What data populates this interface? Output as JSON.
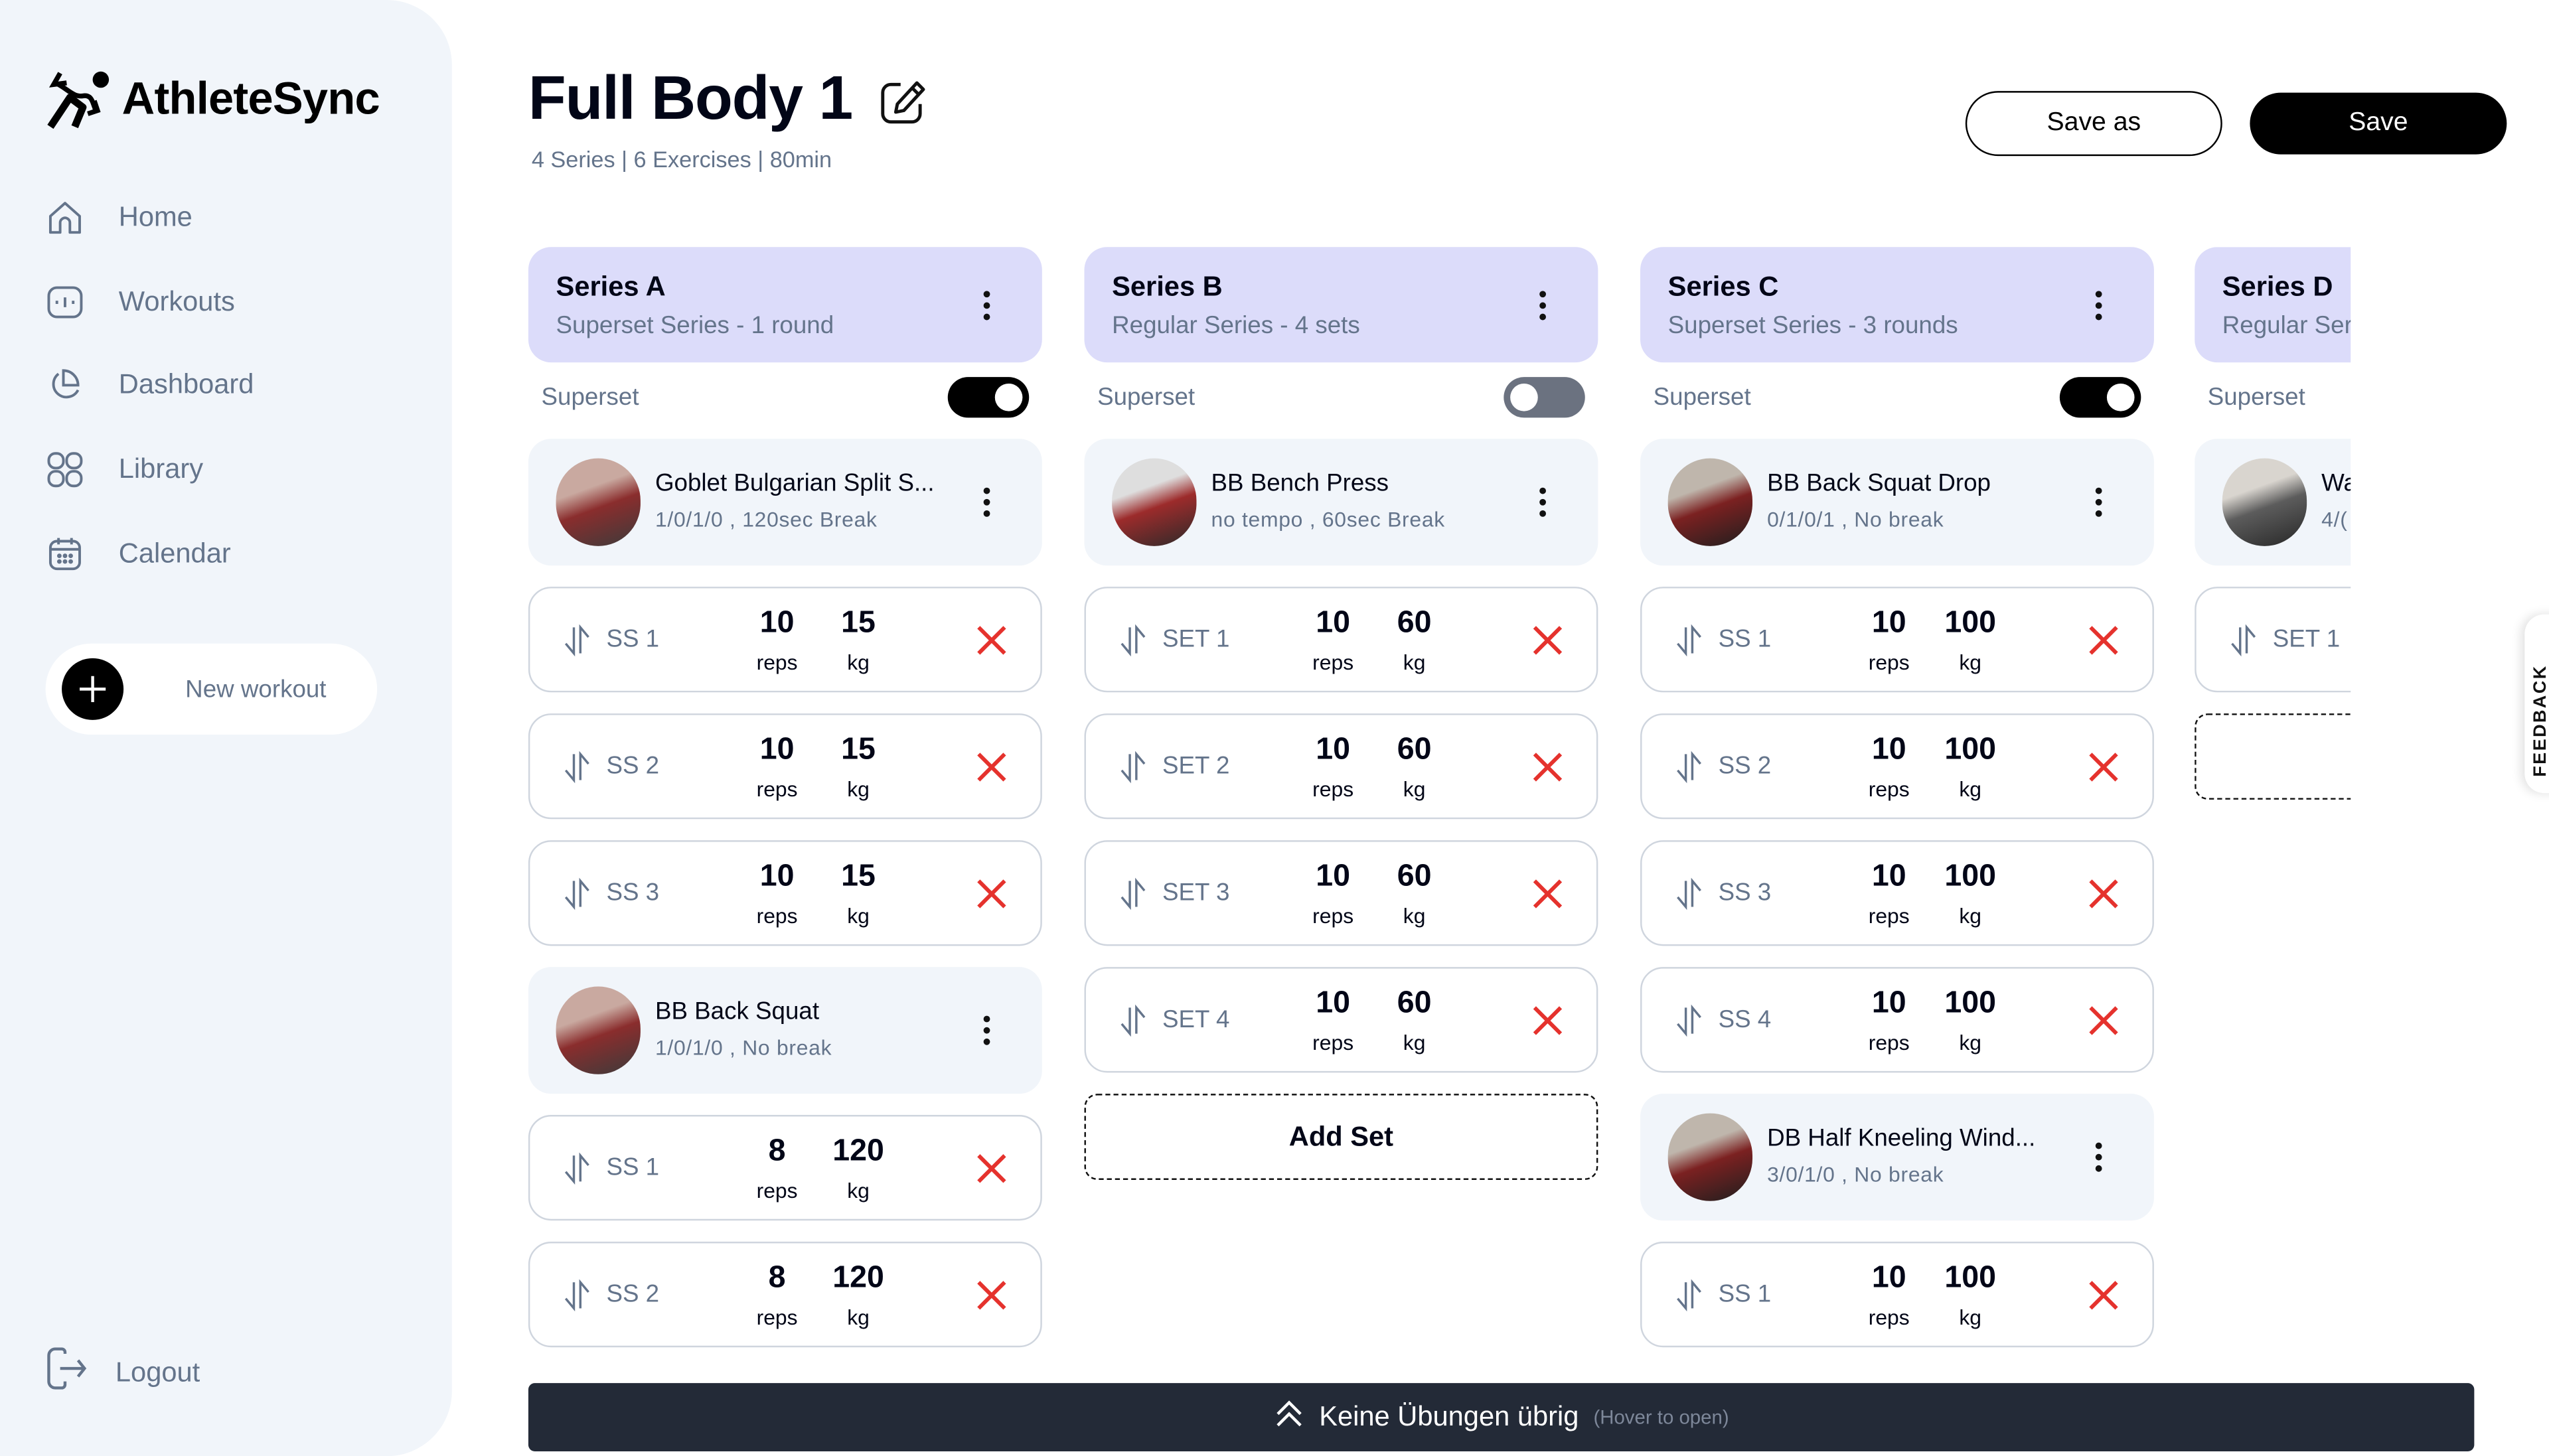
{
  "app": {
    "name": "AthleteSync"
  },
  "sidebar": {
    "items": [
      {
        "label": "Home",
        "icon": "home-icon"
      },
      {
        "label": "Workouts",
        "icon": "workouts-icon"
      },
      {
        "label": "Dashboard",
        "icon": "pie-chart-icon"
      },
      {
        "label": "Library",
        "icon": "grid-icon"
      },
      {
        "label": "Calendar",
        "icon": "calendar-icon"
      }
    ],
    "new_workout_label": "New workout",
    "logout_label": "Logout"
  },
  "header": {
    "title": "Full Body 1",
    "subtitle": "4 Series | 6 Exercises | 80min",
    "save_as_label": "Save as",
    "save_label": "Save"
  },
  "labels": {
    "superset": "Superset",
    "reps": "reps",
    "kg": "kg",
    "add_set": "Add Set"
  },
  "series": [
    {
      "name": "Series A",
      "subtitle": "Superset Series - 1 round",
      "superset": true,
      "blocks": [
        {
          "type": "exercise",
          "name": "Goblet Bulgarian Split S...",
          "meta": "1/0/1/0  , 120sec Break"
        },
        {
          "type": "set",
          "label": "SS 1",
          "reps": "10",
          "kg": "15"
        },
        {
          "type": "set",
          "label": "SS 2",
          "reps": "10",
          "kg": "15"
        },
        {
          "type": "set",
          "label": "SS 3",
          "reps": "10",
          "kg": "15"
        },
        {
          "type": "exercise",
          "name": "BB Back Squat",
          "meta": "1/0/1/0  , No break"
        },
        {
          "type": "set",
          "label": "SS 1",
          "reps": "8",
          "kg": "120"
        },
        {
          "type": "set",
          "label": "SS 2",
          "reps": "8",
          "kg": "120"
        }
      ]
    },
    {
      "name": "Series B",
      "subtitle": "Regular Series - 4 sets",
      "superset": false,
      "blocks": [
        {
          "type": "exercise",
          "name": "BB Bench Press",
          "meta": "no tempo  , 60sec Break"
        },
        {
          "type": "set",
          "label": "SET 1",
          "reps": "10",
          "kg": "60"
        },
        {
          "type": "set",
          "label": "SET 2",
          "reps": "10",
          "kg": "60"
        },
        {
          "type": "set",
          "label": "SET 3",
          "reps": "10",
          "kg": "60"
        },
        {
          "type": "set",
          "label": "SET 4",
          "reps": "10",
          "kg": "60"
        },
        {
          "type": "add"
        }
      ]
    },
    {
      "name": "Series C",
      "subtitle": "Superset Series - 3 rounds",
      "superset": true,
      "blocks": [
        {
          "type": "exercise",
          "name": "BB Back Squat Drop",
          "meta": "0/1/0/1  , No break"
        },
        {
          "type": "set",
          "label": "SS 1",
          "reps": "10",
          "kg": "100"
        },
        {
          "type": "set",
          "label": "SS 2",
          "reps": "10",
          "kg": "100"
        },
        {
          "type": "set",
          "label": "SS 3",
          "reps": "10",
          "kg": "100"
        },
        {
          "type": "set",
          "label": "SS 4",
          "reps": "10",
          "kg": "100"
        },
        {
          "type": "exercise",
          "name": "DB Half Kneeling Wind...",
          "meta": "3/0/1/0  , No break"
        },
        {
          "type": "set",
          "label": "SS 1",
          "reps": "10",
          "kg": "100"
        }
      ]
    },
    {
      "name": "Series D",
      "subtitle": "Regular Ser",
      "superset": null,
      "blocks": [
        {
          "type": "exercise",
          "name": "Wa",
          "meta": "4/("
        },
        {
          "type": "set",
          "label": "SET 1",
          "reps": "",
          "kg": ""
        },
        {
          "type": "add-empty"
        }
      ]
    }
  ],
  "bottom_bar": {
    "label": "Keine Übungen übrig",
    "hint": "(Hover to open)"
  },
  "feedback_tab": "FEEDBACK",
  "colors": {
    "series_header": "#dcdcfa",
    "sidebar_bg": "#f1f5fa",
    "delete": "#e5322d",
    "bottom_bar": "#232a37",
    "muted_text": "#64748b"
  }
}
